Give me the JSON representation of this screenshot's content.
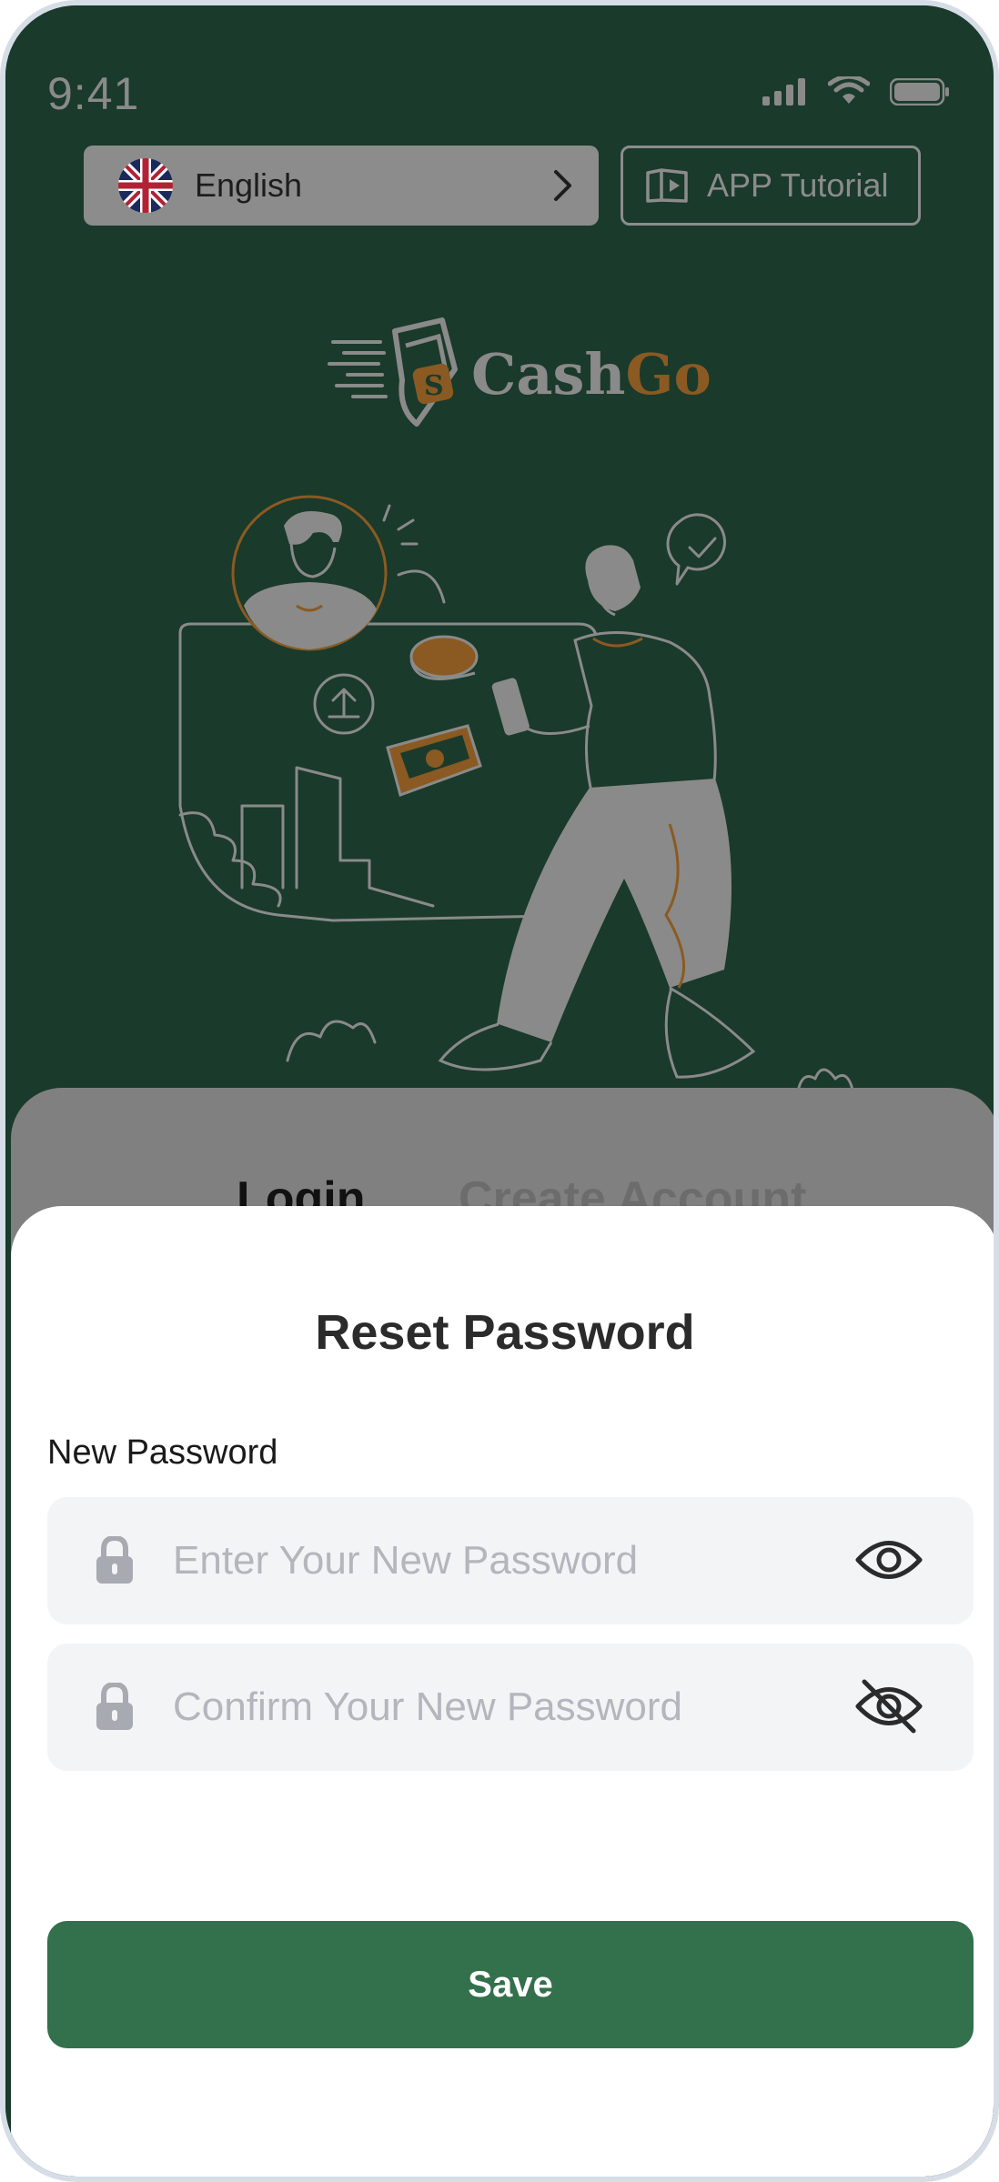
{
  "status_bar": {
    "time": "9:41"
  },
  "language": {
    "label": "English"
  },
  "tutorial": {
    "label": "APP Tutorial"
  },
  "logo": {
    "part1": "Cash",
    "part2": "Go"
  },
  "tabs": {
    "login": "Login",
    "create": "Create Account"
  },
  "sheet": {
    "title": "Reset Password",
    "field_label": "New Password",
    "new_password_placeholder": "Enter Your New Password",
    "confirm_password_placeholder": "Confirm Your New Password",
    "save_label": "Save"
  },
  "colors": {
    "background": "#1a3a2b",
    "accent": "#33704c",
    "brand_orange": "#8a5a22"
  },
  "icons": [
    "uk-flag-icon",
    "chevron-right-icon",
    "book-video-icon",
    "lock-icon",
    "eye-icon",
    "eye-off-icon"
  ]
}
